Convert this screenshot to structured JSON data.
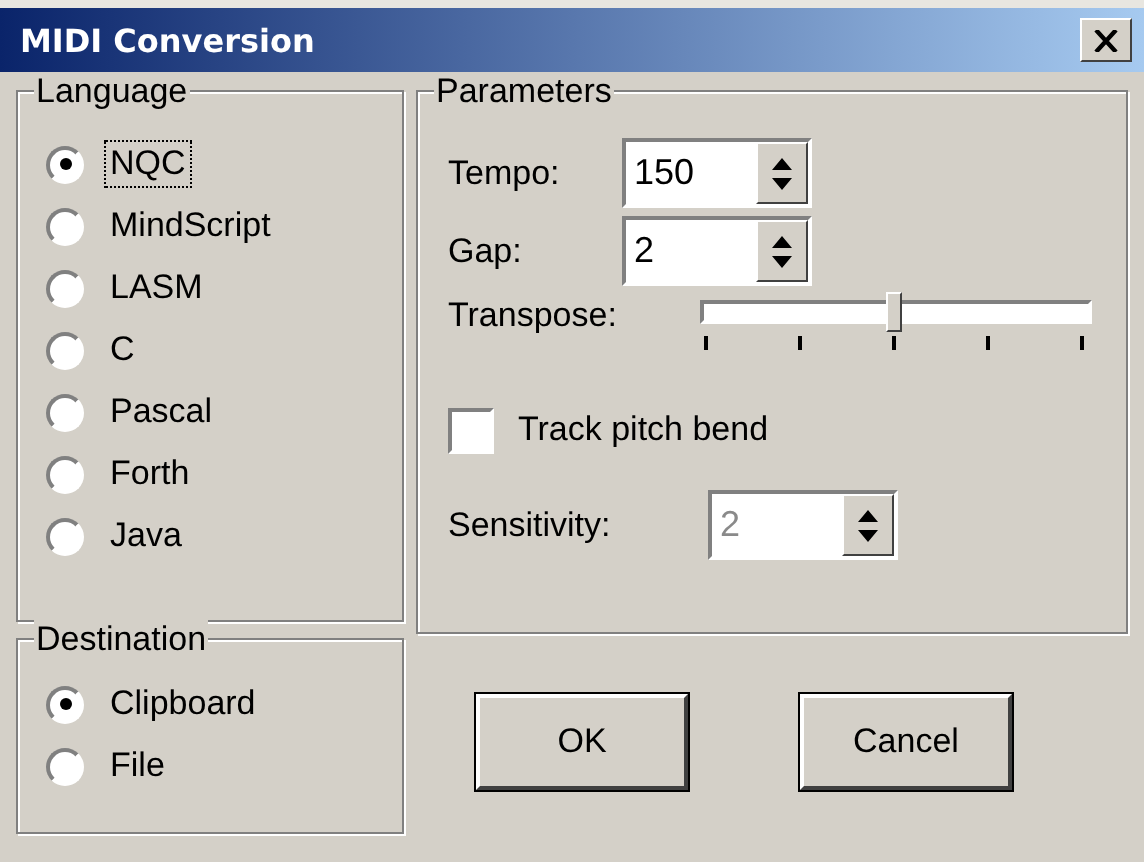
{
  "window": {
    "title": "MIDI Conversion"
  },
  "language": {
    "label": "Language",
    "options": [
      {
        "label": "NQC",
        "selected": true,
        "focused": true
      },
      {
        "label": "MindScript",
        "selected": false,
        "focused": false
      },
      {
        "label": "LASM",
        "selected": false,
        "focused": false
      },
      {
        "label": "C",
        "selected": false,
        "focused": false
      },
      {
        "label": "Pascal",
        "selected": false,
        "focused": false
      },
      {
        "label": "Forth",
        "selected": false,
        "focused": false
      },
      {
        "label": "Java",
        "selected": false,
        "focused": false
      }
    ]
  },
  "parameters": {
    "label": "Parameters",
    "tempo": {
      "label": "Tempo:",
      "value": "150",
      "disabled": false
    },
    "gap": {
      "label": "Gap:",
      "value": "2",
      "disabled": false
    },
    "transpose": {
      "label": "Transpose:",
      "level": 0.5
    },
    "track_pitch_bend": {
      "label": "Track pitch bend",
      "checked": false
    },
    "sensitivity": {
      "label": "Sensitivity:",
      "value": "2",
      "disabled": true
    }
  },
  "destination": {
    "label": "Destination",
    "options": [
      {
        "label": "Clipboard",
        "selected": true
      },
      {
        "label": "File",
        "selected": false
      }
    ]
  },
  "buttons": [
    {
      "label": "OK"
    },
    {
      "label": "Cancel"
    }
  ]
}
